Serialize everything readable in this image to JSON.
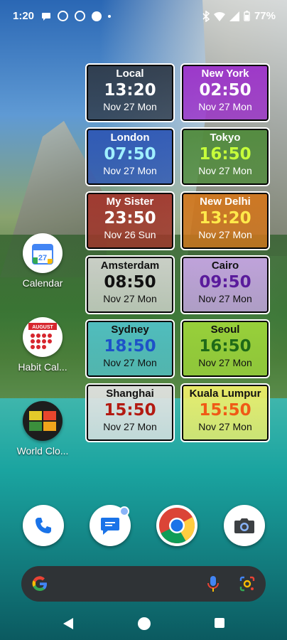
{
  "status_bar": {
    "time": "1:20",
    "battery": "77%",
    "icons": [
      "chat-bubble-icon",
      "ring-icon",
      "ring-icon",
      "circle-icon",
      "dot-icon",
      "bluetooth-icon",
      "wifi-icon",
      "signal-icon",
      "battery-icon"
    ]
  },
  "clocks": [
    {
      "city": "Local",
      "time": "13:20",
      "date": "Nov 27 Mon",
      "bg": "#2f3a48",
      "time_color": "#ffffff"
    },
    {
      "city": "New York",
      "time": "02:50",
      "date": "Nov 27 Mon",
      "bg": "#9b2fc9",
      "time_color": "#ffffff"
    },
    {
      "city": "London",
      "time": "07:50",
      "date": "Nov 27 Mon",
      "bg": "#2d56b4",
      "time_color": "#9ff0ff"
    },
    {
      "city": "Tokyo",
      "time": "16:50",
      "date": "Nov 27 Mon",
      "bg": "#4f8a3a",
      "time_color": "#c6ff3a"
    },
    {
      "city": "My Sister",
      "time": "23:50",
      "date": "Nov 26 Sun",
      "bg": "#a2352b",
      "time_color": "#ffffff"
    },
    {
      "city": "New Delhi",
      "time": "13:20",
      "date": "Nov 27 Mon",
      "bg": "#d2761c",
      "time_color": "#ffe94a"
    },
    {
      "city": "Amsterdam",
      "time": "08:50",
      "date": "Nov 27 Mon",
      "bg": "#d3d6d0",
      "time_color": "#111111"
    },
    {
      "city": "Cairo",
      "time": "09:50",
      "date": "Nov 27 Mon",
      "bg": "#c8a6e6",
      "time_color": "#5a1b9c"
    },
    {
      "city": "Sydney",
      "time": "18:50",
      "date": "Nov 27 Mon",
      "bg": "#52c2c8",
      "time_color": "#1e52c8"
    },
    {
      "city": "Seoul",
      "time": "16:50",
      "date": "Nov 27 Mon",
      "bg": "#9ed63a",
      "time_color": "#1f6a18"
    },
    {
      "city": "Shanghai",
      "time": "15:50",
      "date": "Nov 27 Mon",
      "bg": "#e4e4e4",
      "time_color": "#b31a12"
    },
    {
      "city": "Kuala Lumpur",
      "time": "15:50",
      "date": "Nov 27 Mon",
      "bg": "#f1f06a",
      "time_color": "#f05a16"
    }
  ],
  "home_apps": [
    {
      "label": "Calendar",
      "icon": "calendar-icon",
      "day": "27"
    },
    {
      "label": "Habit Cal...",
      "icon": "habit-calendar-icon",
      "badge": "AUGUST"
    },
    {
      "label": "World Clo...",
      "icon": "world-clock-icon"
    }
  ],
  "dock": [
    "phone-icon",
    "messages-icon",
    "chrome-icon",
    "camera-icon"
  ],
  "search": {
    "logo": "google-g-icon",
    "mic": "mic-icon",
    "lens": "lens-icon"
  },
  "nav": [
    "back-icon",
    "home-icon",
    "recents-icon"
  ]
}
